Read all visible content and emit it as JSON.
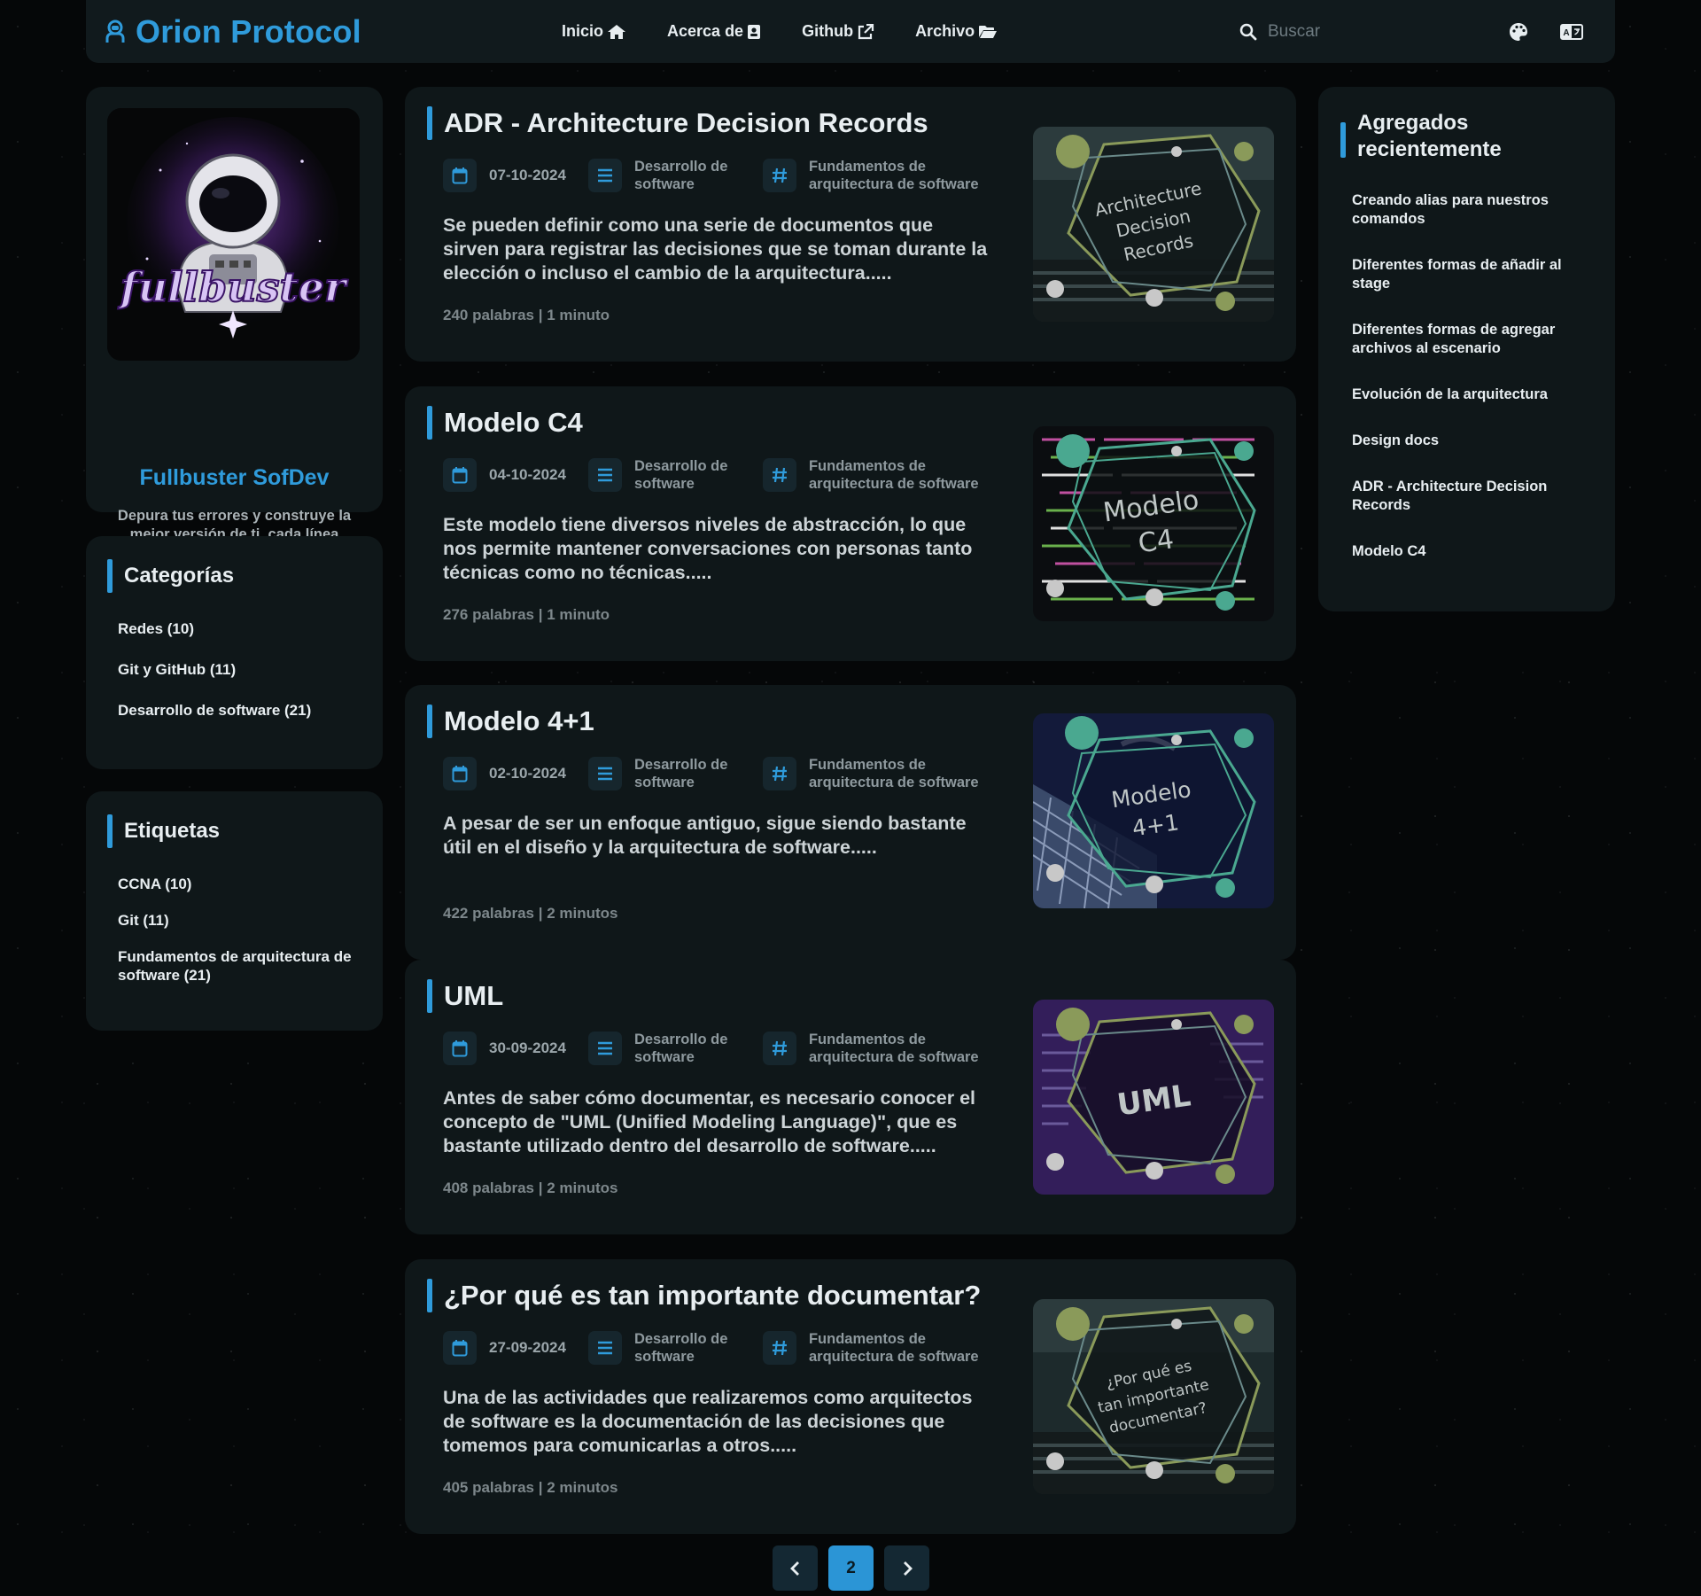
{
  "navbar": {
    "brand": "Orion Protocol",
    "links": [
      {
        "label": "Inicio",
        "icon": "home-icon"
      },
      {
        "label": "Acerca de",
        "icon": "contact-card-icon"
      },
      {
        "label": "Github",
        "icon": "external-link-icon"
      },
      {
        "label": "Archivo",
        "icon": "folder-open-icon"
      }
    ],
    "search_placeholder": "Buscar",
    "tools": [
      "palette-icon",
      "language-icon"
    ]
  },
  "profile": {
    "avatar_text": "fullbuster",
    "name": "Fullbuster SofDev",
    "bio": "Depura tus errores y construye la mejor versión de ti, cada línea cuenta"
  },
  "categories": {
    "title": "Categorías",
    "items": [
      "Redes (10)",
      "Git y GitHub (11)",
      "Desarrollo de software (21)"
    ]
  },
  "tags": {
    "title": "Etiquetas",
    "items": [
      "CCNA (10)",
      "Git (11)",
      "Fundamentos de arquitectura de software (21)"
    ]
  },
  "recent": {
    "title": "Agregados recientemente",
    "items": [
      "Creando alias para nuestros comandos",
      "Diferentes formas de añadir al stage",
      "Diferentes formas de agregar archivos al escenario",
      "Evolución de la arquitectura",
      "Design docs",
      "ADR - Architecture Decision Records",
      "Modelo C4"
    ]
  },
  "posts": [
    {
      "title": "ADR - Architecture Decision Records",
      "date": "07-10-2024",
      "category": "Desarrollo de software",
      "tag": "Fundamentos de arquitectura de software",
      "excerpt": "Se pueden definir como una serie de documentos que sirven para registrar las decisiones que se toman durante la elección o incluso el cambio de la arquitectura.....",
      "stats": "240 palabras | 1 minuto",
      "thumb_lines": [
        "Architecture",
        "Decision",
        "Records"
      ]
    },
    {
      "title": "Modelo C4",
      "date": "04-10-2024",
      "category": "Desarrollo de software",
      "tag": "Fundamentos de arquitectura de software",
      "excerpt": "Este modelo tiene diversos niveles de abstracción, lo que nos permite mantener conversaciones con personas tanto técnicas como no técnicas.....",
      "stats": "276 palabras | 1 minuto",
      "thumb_lines": [
        "Modelo",
        "C4"
      ]
    },
    {
      "title": "Modelo 4+1",
      "date": "02-10-2024",
      "category": "Desarrollo de software",
      "tag": "Fundamentos de arquitectura de software",
      "excerpt": "A pesar de ser un enfoque antiguo, sigue siendo bastante útil en el diseño y la arquitectura de software.....",
      "stats": "422 palabras | 2 minutos",
      "thumb_lines": [
        "Modelo",
        "4+1"
      ]
    },
    {
      "title": "UML",
      "date": "30-09-2024",
      "category": "Desarrollo de software",
      "tag": "Fundamentos de arquitectura de software",
      "excerpt": "Antes de saber cómo documentar, es necesario conocer el concepto de \"UML (Unified Modeling Language)\", que es bastante utilizado dentro del desarrollo de software.....",
      "stats": "408 palabras | 2 minutos",
      "thumb_lines": [
        "UML"
      ]
    },
    {
      "title": "¿Por qué es tan importante documentar?",
      "date": "27-09-2024",
      "category": "Desarrollo de software",
      "tag": "Fundamentos de arquitectura de software",
      "excerpt": "Una de las actividades que realizaremos como arquitectos de software es la documentación de las decisiones que tomemos para comunicarlas a otros.....",
      "stats": "405 palabras | 2 minutos",
      "thumb_lines": [
        "¿Por qué es",
        "tan importante",
        "documentar?"
      ]
    }
  ],
  "pagination": {
    "current": "2",
    "prev_icon": "chevron-left-icon",
    "next_icon": "chevron-right-icon"
  },
  "colors": {
    "accent": "#2f9bdb",
    "panel": "#0f1719",
    "background": "#050708"
  }
}
